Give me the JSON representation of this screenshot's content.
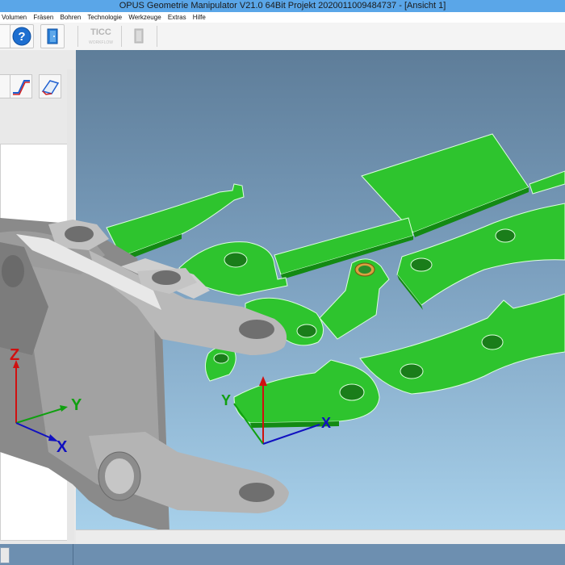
{
  "window": {
    "title": "OPUS Geometrie Manipulator V21.0 64Bit   Projekt 2020011009484737 - [Ansicht 1]"
  },
  "menu": {
    "items": [
      "Volumen",
      "Fräsen",
      "Bohren",
      "Technologie",
      "Werkzeuge",
      "Extras",
      "Hilfe"
    ]
  },
  "toolbar": {
    "help_icon": "question-mark-icon",
    "exit_icon": "door-exit-icon",
    "ticc_label": "TICC",
    "ticc_sub": "WORKFLOW"
  },
  "axes": {
    "z": "Z",
    "y": "Y",
    "x": "X"
  },
  "colors": {
    "part_green": "#1fb81f",
    "part_gray": "#a9a9a9",
    "axis_red": "#d01010",
    "axis_green": "#10a010",
    "axis_blue": "#1010c0"
  }
}
